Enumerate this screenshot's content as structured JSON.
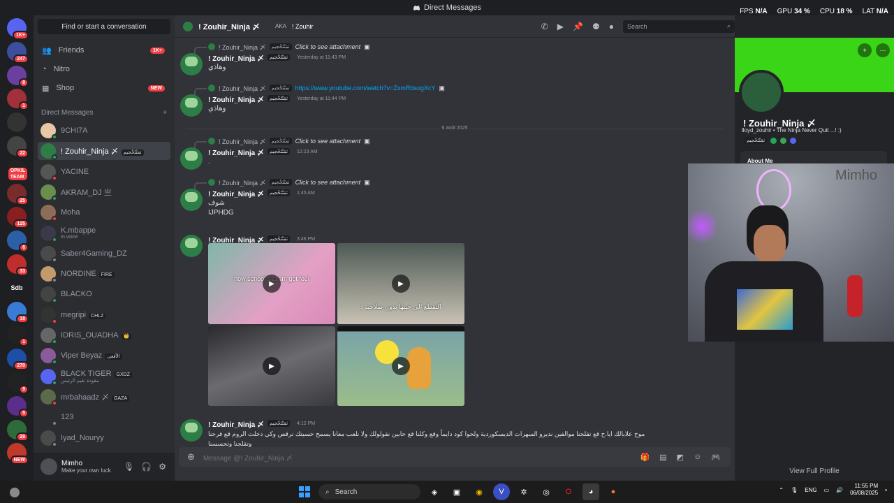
{
  "window": {
    "title": "Direct Messages"
  },
  "overlay": {
    "fps_label": "FPS",
    "fps": "N/A",
    "gpu_label": "GPU",
    "gpu": "34 %",
    "cpu_label": "CPU",
    "cpu": "18 %",
    "lat_label": "LAT",
    "lat": "N/A"
  },
  "servers": [
    {
      "badge": "1K+"
    },
    {
      "badge": "247"
    },
    {
      "badge": "8"
    },
    {
      "badge": "1"
    },
    {
      "badge": ""
    },
    {
      "badge": "22"
    },
    {
      "badge": "OPKIL TEAM"
    },
    {
      "badge": "25"
    },
    {
      "badge": "125"
    },
    {
      "badge": "6"
    },
    {
      "badge": "33"
    },
    {
      "label": "Sdb"
    },
    {
      "badge": "18"
    },
    {
      "badge": "1"
    },
    {
      "badge": "270"
    },
    {
      "badge": "9"
    },
    {
      "badge": "5"
    },
    {
      "badge": "29"
    },
    {
      "badge": "NEW"
    }
  ],
  "sidebar": {
    "find_placeholder": "Find or start a conversation",
    "friends": "Friends",
    "friends_badge": "1K+",
    "nitro": "Nitro",
    "shop": "Shop",
    "shop_badge": "NEW",
    "dm_header": "Direct Messages",
    "dm_add": "+",
    "dms": [
      {
        "name": "9CHI7A",
        "tag": ""
      },
      {
        "name": "! Zouhir_Ninja 〆",
        "tag": "ثمَنْتَحْجيم"
      },
      {
        "name": "YACINE",
        "tag": ""
      },
      {
        "name": "AKRAM_DJ 亗",
        "tag": ""
      },
      {
        "name": "Moha",
        "tag": ""
      },
      {
        "name": "K.mbappe",
        "tag": "",
        "sub": "In voice"
      },
      {
        "name": "Saber4Gaming_DZ",
        "tag": ""
      },
      {
        "name": "NORDINE",
        "tag": "FIRE"
      },
      {
        "name": "BLACKO",
        "tag": ""
      },
      {
        "name": "megripi",
        "tag": "CHLZ"
      },
      {
        "name": "IDRIS_OUADHA",
        "tag": "👑"
      },
      {
        "name": "Viper Beyaz",
        "tag": "الأفعى"
      },
      {
        "name": "BLACK TIGER",
        "tag": "GXDZ",
        "sub": "مقودة تقيم الرئيس"
      },
      {
        "name": "mrbahaadz 〆",
        "tag": "GAZA"
      },
      {
        "name": "123",
        "tag": ""
      },
      {
        "name": "Iyad_Nouryy",
        "tag": ""
      }
    ]
  },
  "user": {
    "name": "Mimho",
    "status": "Make your own luck"
  },
  "chat": {
    "header_name": "! Zouhir_Ninja 〆",
    "header_aka": "AKA",
    "header_alias": "! Zouhir",
    "search_placeholder": "Search",
    "composer_placeholder": "Message @! Zouhir_Ninja 〆",
    "date_divider": "6 août 2025",
    "author": "! Zouhir_Ninja 〆",
    "clan": "ثمَنْتَحْجيم",
    "messages": [
      {
        "reply": "Click to see attachment",
        "time": "Yesterday at 11:43 PM",
        "text": "وهاذي"
      },
      {
        "reply": "https://www.youtube.com/watch?v=ZxmRbsogXcY",
        "time": "Yesterday at 11:44 PM",
        "text": "وهاذي"
      },
      {
        "reply": "Click to see attachment",
        "time": "12:23 AM",
        "text": "."
      },
      {
        "reply": "Click to see attachment",
        "time": "1:45 AM",
        "text": "شوف",
        "text2": "IJPHDG"
      },
      {
        "time": "3:46 PM"
      },
      {
        "time": "4:12 PM",
        "text": "موح علابالك ايا.ح قع تقلجنا موالفين نديرو السهرات الديسكوردية ولحوا كود دايماً وقع وكلنا قع حابين نقولولك ولا نلعب معانا يسمح حسيتك نرقص وكي دخلت الروم قع فرحنا وتقلجنا وتحسسنا"
      }
    ],
    "media": [
      {
        "caption": "how school's exam got feel"
      },
      {
        "caption": "التقطع الى حينها بدون صلاحية ؛"
      },
      {
        "caption": ""
      },
      {
        "caption": ""
      }
    ]
  },
  "profile": {
    "name": "! Zouhir_Ninja 〆",
    "bio": "lloyd_zouhir • The Ninja Never Quit ...! :)",
    "clan": "ثمَنْتَحْجيم",
    "about": "About Me",
    "view_full": "View Full Profile"
  },
  "webcam": {
    "wall_text": "Mimho"
  },
  "taskbar": {
    "search": "Search",
    "lang": "ENG",
    "time": "11:55 PM",
    "date": "06/08/2025"
  },
  "colors": {
    "accent": "#5865f2",
    "banner": "#3bd518",
    "danger": "#f23f43",
    "online": "#23a55a",
    "link": "#00a8fc"
  }
}
